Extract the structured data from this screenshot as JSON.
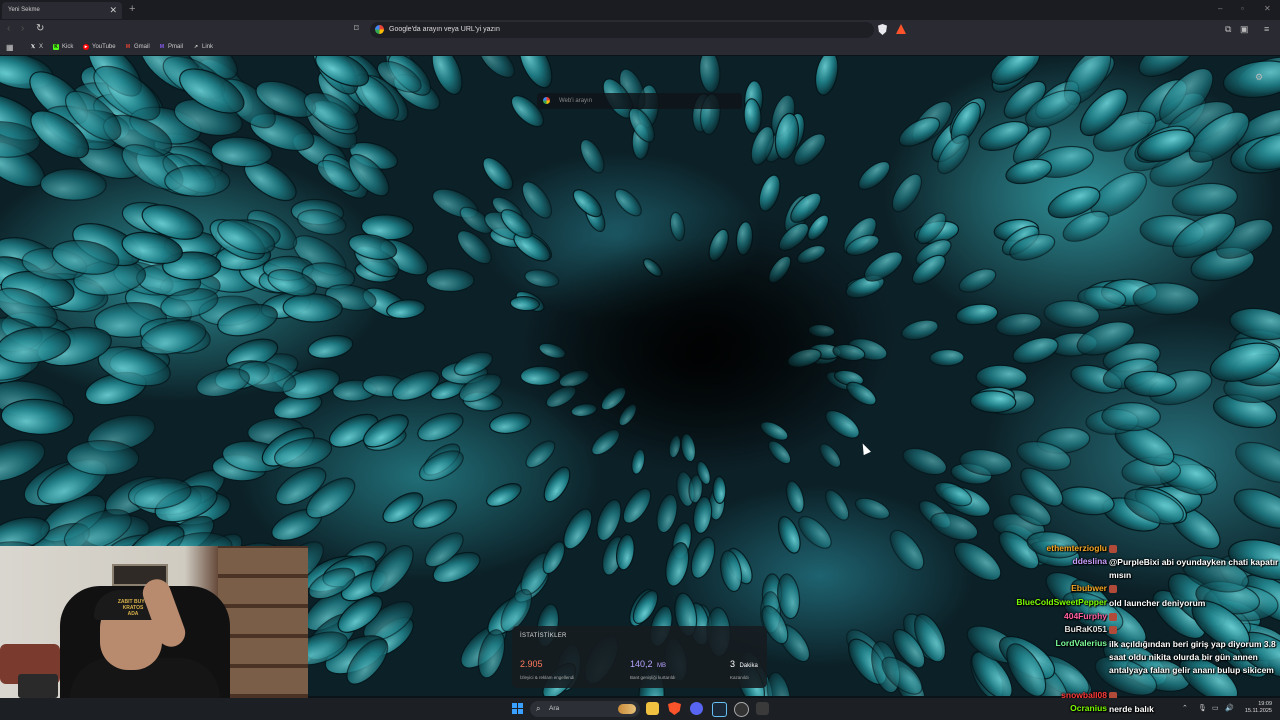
{
  "browser": {
    "tab_title": "Yeni Sekme",
    "tab_close": "✕",
    "new_tab": "+",
    "window_controls": [
      "–",
      "▫",
      "✕"
    ],
    "omnibox_text": "Google'da arayın veya URL'yi yazın",
    "bookmarks": [
      {
        "label": "X",
        "icon": "x-icon",
        "color": "#ffffff"
      },
      {
        "label": "Kick",
        "icon": "kick-icon",
        "color": "#53fc18"
      },
      {
        "label": "YouTube",
        "icon": "youtube-icon",
        "color": "#ff0000"
      },
      {
        "label": "Gmail",
        "icon": "gmail-icon",
        "color": "#ea4335"
      },
      {
        "label": "Pmail",
        "icon": "pmail-icon",
        "color": "#8b5cf6"
      },
      {
        "label": "Link",
        "icon": "link-icon",
        "color": "#cccccc"
      }
    ]
  },
  "new_tab_page": {
    "search_placeholder": "Web'i arayın"
  },
  "stats": {
    "title": "İSTATİSTİKLER",
    "items": [
      {
        "value": "2.905",
        "unit": "",
        "label": "İzleyici & reklam engellendi",
        "color": "#ff7a5c"
      },
      {
        "value": "140,2",
        "unit": "MB",
        "label": "Bant genişliği kurtarıldı",
        "color": "#b8a3ff"
      },
      {
        "value": "3",
        "unit": "Dakika",
        "label": "Kazanıldı",
        "color": "#ffffff"
      }
    ]
  },
  "webcam": {
    "cap_text": "ZABIT BUYU\nKRATOS\nADA"
  },
  "chat": [
    {
      "user": "ethemterzioglu",
      "color": "#f5a623",
      "message": ""
    },
    {
      "user": "ddeslina",
      "color": "#c9a0ff",
      "message": "@PurpleBixi abi oyundayken chati kapatır mısın"
    },
    {
      "user": "Ebubwer",
      "color": "#f5a623",
      "message": ""
    },
    {
      "user": "BlueColdSweetPepper",
      "color": "#7CFC00",
      "message": "old launcher deniyorum"
    },
    {
      "user": "404Furphy",
      "color": "#ff5fa2",
      "message": ""
    },
    {
      "user": "BuRaK051",
      "color": "#e0e0e0",
      "message": ""
    },
    {
      "user": "LordValerius",
      "color": "#7CFC9A",
      "message": "ilk açıldığından beri giriş yap diyorum 3.8 saat oldu nikita olurda bir gün annen antalyaya falan gelir ananı bulup sikicem"
    },
    {
      "user": "snowball08",
      "color": "#ff3b3b",
      "message": ""
    },
    {
      "user": "Ocranius",
      "color": "#7CFC00",
      "message": "nerde balık"
    }
  ],
  "taskbar": {
    "search_placeholder": "Ara",
    "time": "19:09",
    "date": "15.11.2025"
  }
}
